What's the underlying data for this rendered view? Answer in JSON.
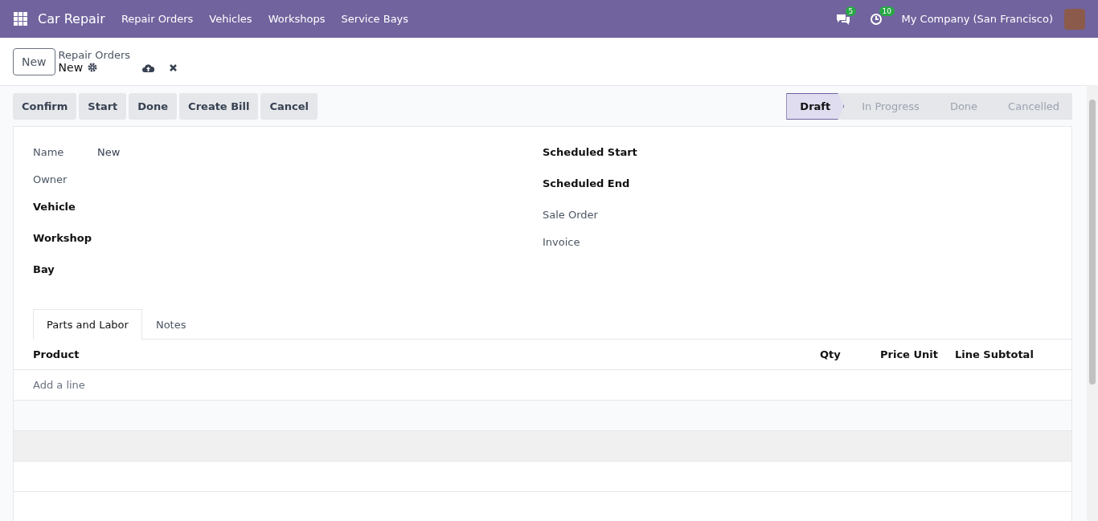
{
  "navbar": {
    "app_name": "Car Repair",
    "menu": [
      "Repair Orders",
      "Vehicles",
      "Workshops",
      "Service Bays"
    ],
    "messages_count": "5",
    "activities_count": "10",
    "company": "My Company (San Francisco)"
  },
  "control_panel": {
    "new_button": "New",
    "breadcrumb": "Repair Orders",
    "record": "New"
  },
  "action_buttons": [
    "Confirm",
    "Start",
    "Done",
    "Create Bill",
    "Cancel"
  ],
  "statusbar": [
    {
      "label": "Draft",
      "selected": true
    },
    {
      "label": "In Progress",
      "selected": false
    },
    {
      "label": "Done",
      "selected": false
    },
    {
      "label": "Cancelled",
      "selected": false
    }
  ],
  "left_fields": [
    {
      "label": "Name",
      "value": "New",
      "required": false
    },
    {
      "label": "Owner",
      "required": false
    },
    {
      "label": "Vehicle",
      "required": true
    },
    {
      "label": "Workshop",
      "required": true
    },
    {
      "label": "Bay",
      "required": true
    }
  ],
  "right_fields": [
    {
      "label": "Scheduled Start",
      "required": true
    },
    {
      "label": "Scheduled End",
      "required": true
    },
    {
      "label": "Sale Order",
      "required": false
    },
    {
      "label": "Invoice",
      "required": false
    }
  ],
  "tabs": [
    {
      "label": "Parts and Labor",
      "selected": true
    },
    {
      "label": "Notes",
      "selected": false
    }
  ],
  "table": {
    "columns": [
      "Product",
      "Qty",
      "Price Unit",
      "Line Subtotal"
    ],
    "add_line": "Add a line"
  }
}
